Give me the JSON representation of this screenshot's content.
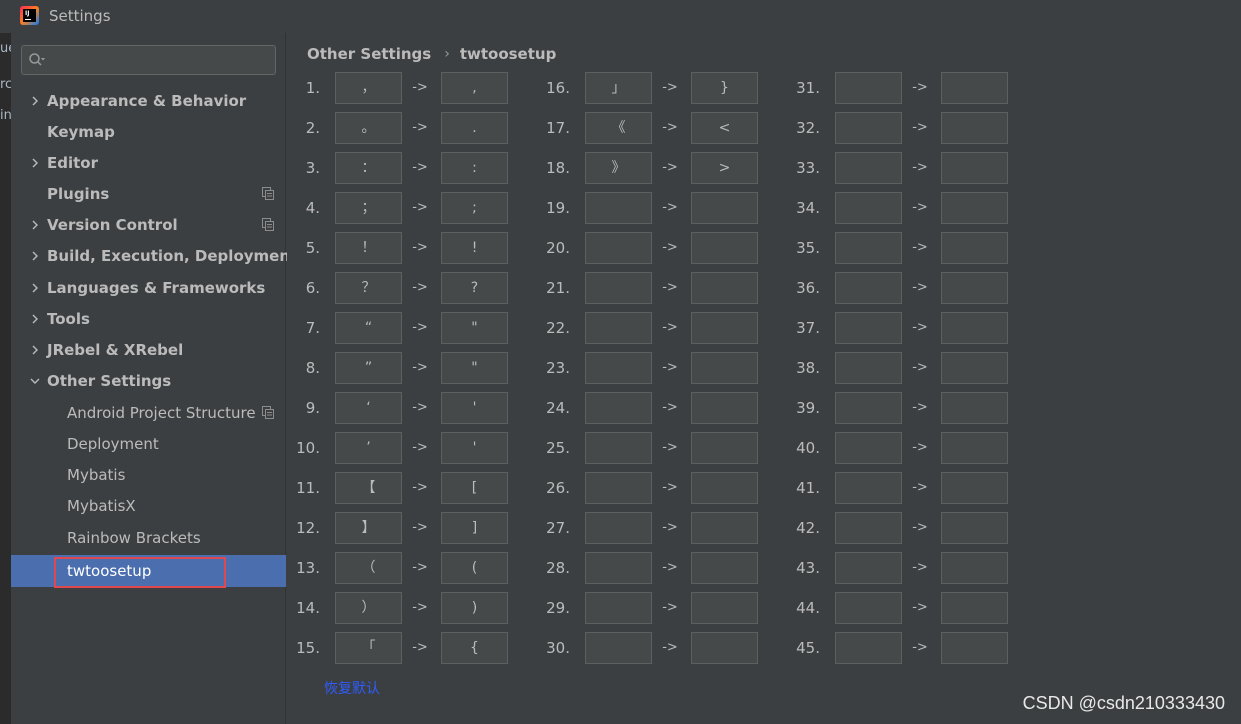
{
  "window": {
    "title": "Settings"
  },
  "background_editor_fragments": [
    "ue",
    "rc",
    "in"
  ],
  "search": {
    "value": "",
    "placeholder": ""
  },
  "sidebar": {
    "items": [
      {
        "label": "Appearance & Behavior",
        "expandable": true,
        "expanded": false,
        "level": 0,
        "copy_icon": false
      },
      {
        "label": "Keymap",
        "expandable": false,
        "expanded": false,
        "level": 0,
        "copy_icon": false
      },
      {
        "label": "Editor",
        "expandable": true,
        "expanded": false,
        "level": 0,
        "copy_icon": false
      },
      {
        "label": "Plugins",
        "expandable": false,
        "expanded": false,
        "level": 0,
        "copy_icon": true
      },
      {
        "label": "Version Control",
        "expandable": true,
        "expanded": false,
        "level": 0,
        "copy_icon": true
      },
      {
        "label": "Build, Execution, Deployment",
        "expandable": true,
        "expanded": false,
        "level": 0,
        "copy_icon": false
      },
      {
        "label": "Languages & Frameworks",
        "expandable": true,
        "expanded": false,
        "level": 0,
        "copy_icon": false
      },
      {
        "label": "Tools",
        "expandable": true,
        "expanded": false,
        "level": 0,
        "copy_icon": false
      },
      {
        "label": "JRebel & XRebel",
        "expandable": true,
        "expanded": false,
        "level": 0,
        "copy_icon": false
      },
      {
        "label": "Other Settings",
        "expandable": true,
        "expanded": true,
        "level": 0,
        "copy_icon": false
      },
      {
        "label": "Android Project Structure",
        "expandable": false,
        "expanded": false,
        "level": 1,
        "copy_icon": true
      },
      {
        "label": "Deployment",
        "expandable": false,
        "expanded": false,
        "level": 1,
        "copy_icon": false
      },
      {
        "label": "Mybatis",
        "expandable": false,
        "expanded": false,
        "level": 1,
        "copy_icon": false
      },
      {
        "label": "MybatisX",
        "expandable": false,
        "expanded": false,
        "level": 1,
        "copy_icon": false
      },
      {
        "label": "Rainbow Brackets",
        "expandable": false,
        "expanded": false,
        "level": 1,
        "copy_icon": false
      },
      {
        "label": "twtoosetup",
        "expandable": false,
        "expanded": false,
        "level": 1,
        "copy_icon": false,
        "selected": true
      }
    ]
  },
  "breadcrumb": {
    "parent": "Other Settings",
    "separator": "›",
    "current": "twtoosetup"
  },
  "arrow_label": "->",
  "mappings": [
    {
      "num": "1.",
      "from": "，",
      "to": ","
    },
    {
      "num": "2.",
      "from": "。",
      "to": "."
    },
    {
      "num": "3.",
      "from": "：",
      "to": ":"
    },
    {
      "num": "4.",
      "from": "；",
      "to": ";"
    },
    {
      "num": "5.",
      "from": "！",
      "to": "!"
    },
    {
      "num": "6.",
      "from": "？",
      "to": "?"
    },
    {
      "num": "7.",
      "from": "“",
      "to": "\""
    },
    {
      "num": "8.",
      "from": "”",
      "to": "\""
    },
    {
      "num": "9.",
      "from": "‘",
      "to": "'"
    },
    {
      "num": "10.",
      "from": "’",
      "to": "'"
    },
    {
      "num": "11.",
      "from": "【",
      "to": "["
    },
    {
      "num": "12.",
      "from": "】",
      "to": "]"
    },
    {
      "num": "13.",
      "from": "（",
      "to": "("
    },
    {
      "num": "14.",
      "from": "）",
      "to": ")"
    },
    {
      "num": "15.",
      "from": "「",
      "to": "{"
    },
    {
      "num": "16.",
      "from": "」",
      "to": "}"
    },
    {
      "num": "17.",
      "from": "《",
      "to": "<"
    },
    {
      "num": "18.",
      "from": "》",
      "to": ">"
    },
    {
      "num": "19.",
      "from": "",
      "to": ""
    },
    {
      "num": "20.",
      "from": "",
      "to": ""
    },
    {
      "num": "21.",
      "from": "",
      "to": ""
    },
    {
      "num": "22.",
      "from": "",
      "to": ""
    },
    {
      "num": "23.",
      "from": "",
      "to": ""
    },
    {
      "num": "24.",
      "from": "",
      "to": ""
    },
    {
      "num": "25.",
      "from": "",
      "to": ""
    },
    {
      "num": "26.",
      "from": "",
      "to": ""
    },
    {
      "num": "27.",
      "from": "",
      "to": ""
    },
    {
      "num": "28.",
      "from": "",
      "to": ""
    },
    {
      "num": "29.",
      "from": "",
      "to": ""
    },
    {
      "num": "30.",
      "from": "",
      "to": ""
    },
    {
      "num": "31.",
      "from": "",
      "to": ""
    },
    {
      "num": "32.",
      "from": "",
      "to": ""
    },
    {
      "num": "33.",
      "from": "",
      "to": ""
    },
    {
      "num": "34.",
      "from": "",
      "to": ""
    },
    {
      "num": "35.",
      "from": "",
      "to": ""
    },
    {
      "num": "36.",
      "from": "",
      "to": ""
    },
    {
      "num": "37.",
      "from": "",
      "to": ""
    },
    {
      "num": "38.",
      "from": "",
      "to": ""
    },
    {
      "num": "39.",
      "from": "",
      "to": ""
    },
    {
      "num": "40.",
      "from": "",
      "to": ""
    },
    {
      "num": "41.",
      "from": "",
      "to": ""
    },
    {
      "num": "42.",
      "from": "",
      "to": ""
    },
    {
      "num": "43.",
      "from": "",
      "to": ""
    },
    {
      "num": "44.",
      "from": "",
      "to": ""
    },
    {
      "num": "45.",
      "from": "",
      "to": ""
    }
  ],
  "restore_default_label": "恢复默认",
  "watermark": "CSDN @csdn210333430",
  "colors": {
    "background": "#3c3f41",
    "selection": "#4b6eaf",
    "highlight_border": "#e0474f",
    "link": "#2e5cff"
  }
}
